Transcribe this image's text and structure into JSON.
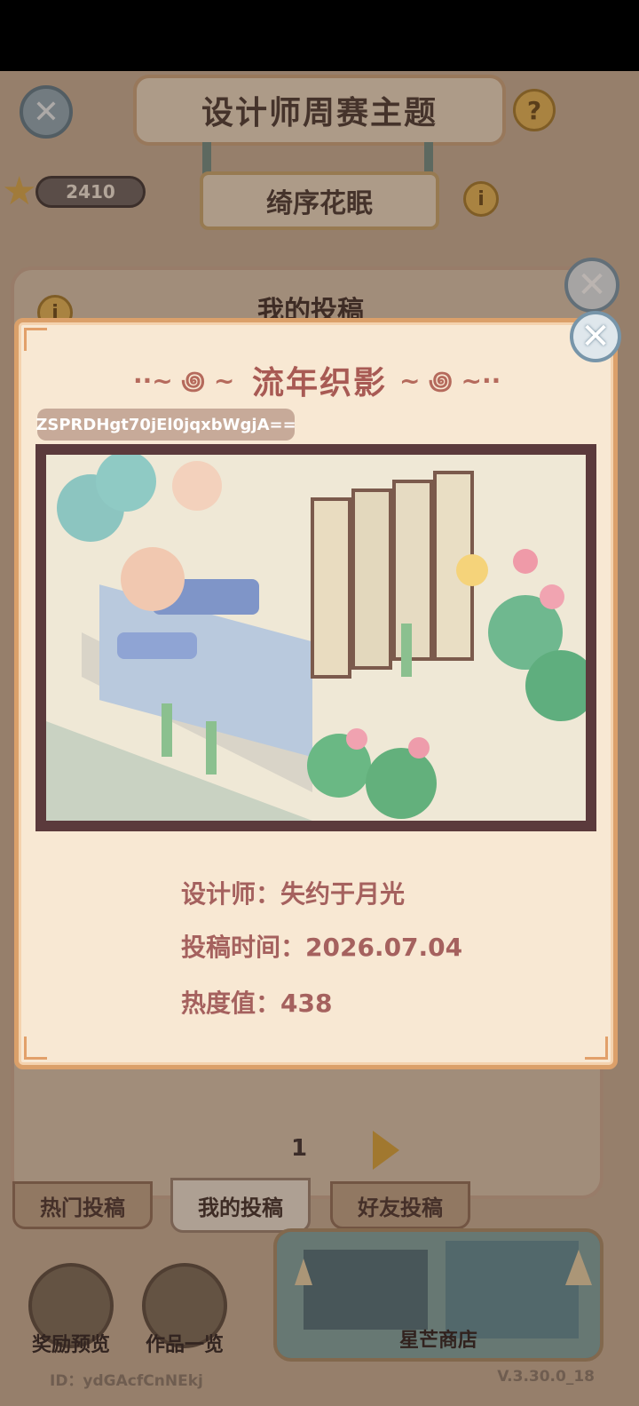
{
  "header": {
    "title": "设计师周赛主题",
    "theme_name": "绮序花眠",
    "score": "2410"
  },
  "panel": {
    "title": "我的投稿",
    "page": "1"
  },
  "tabs": [
    {
      "label": "热门投稿"
    },
    {
      "label": "我的投稿"
    },
    {
      "label": "好友投稿"
    }
  ],
  "bottom": {
    "reward_label": "奖励预览",
    "works_label": "作品一览",
    "shop_label": "星芒商店"
  },
  "footer": {
    "id_text": "ID：ydGAcfCnNEkj",
    "version": "V.3.30.0_18"
  },
  "modal": {
    "title": "流年织影",
    "code": "ZSPRDHgt70jEl0jqxbWgjA==",
    "designer": "设计师：失约于月光",
    "submit_time": "投稿时间：2026.07.04",
    "heat": "热度值：438"
  },
  "colors": {
    "modal_bg": "#f8e8d3",
    "modal_border": "#dba06a",
    "title_color": "#a85a54",
    "info_color": "#a5615e",
    "frame": "#5b3a3c"
  },
  "icons": {
    "close": "close-icon",
    "help": "help-icon",
    "info": "info-icon",
    "star": "star-icon",
    "next": "next-arrow-icon"
  }
}
